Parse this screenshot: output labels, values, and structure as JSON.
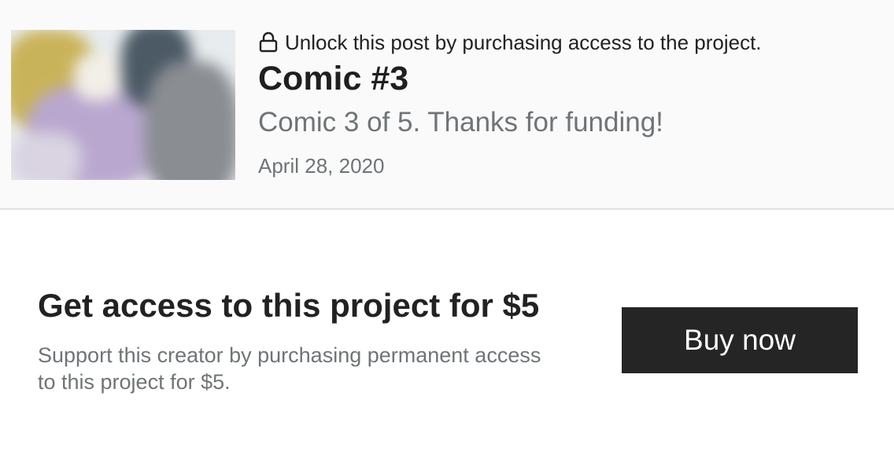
{
  "post": {
    "thumbnail_alt": "Blurred comic preview",
    "lock_icon": "lock-icon",
    "lock_message": "Unlock this post by purchasing access to the project.",
    "title": "Comic #3",
    "subtitle": "Comic 3 of 5. Thanks for funding!",
    "date": "April 28, 2020"
  },
  "offer": {
    "title": "Get access to this project for $5",
    "description": "Support this creator by purchasing permanent access to this project for $5.",
    "button_label": "Buy now",
    "button_color": "#252525"
  }
}
